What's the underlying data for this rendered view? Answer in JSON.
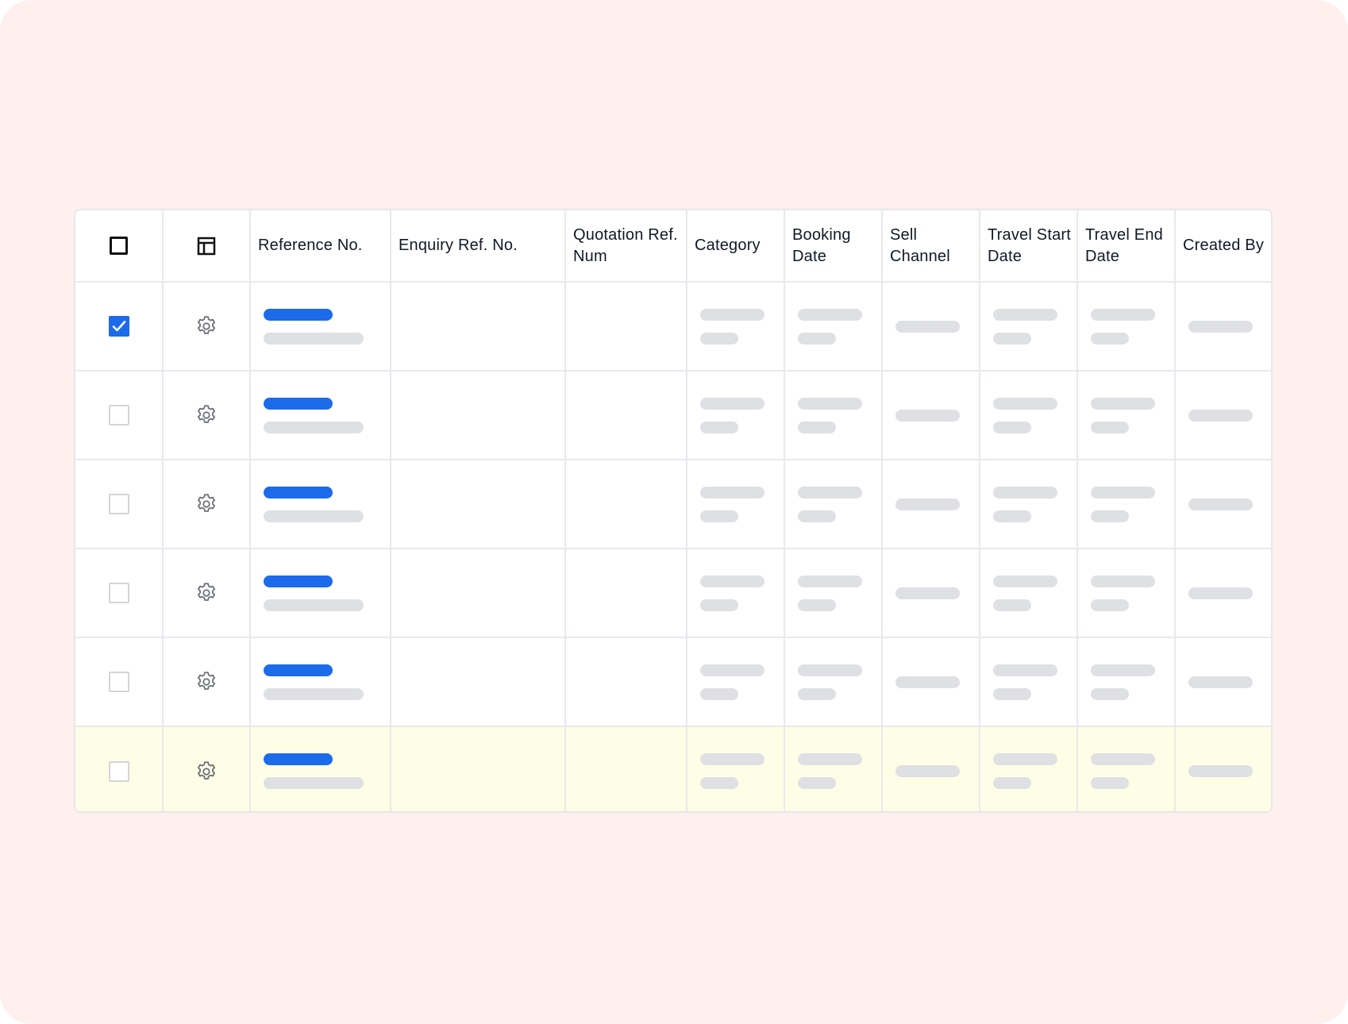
{
  "table": {
    "columns": [
      {
        "key": "select",
        "label": ""
      },
      {
        "key": "settings",
        "label": ""
      },
      {
        "key": "reference_no",
        "label": "Reference No."
      },
      {
        "key": "enquiry_ref_no",
        "label": "Enquiry Ref. No."
      },
      {
        "key": "quotation_ref_num",
        "label": "Quotation Ref. Num"
      },
      {
        "key": "category",
        "label": "Category"
      },
      {
        "key": "booking_date",
        "label": "Booking Date"
      },
      {
        "key": "sell_channel",
        "label": "Sell Channel"
      },
      {
        "key": "travel_start_date",
        "label": "Travel Start Date"
      },
      {
        "key": "travel_end_date",
        "label": "Travel End Date"
      },
      {
        "key": "created_by",
        "label": "Created By"
      }
    ],
    "header_icons": {
      "select_all": "checkbox-unchecked-icon",
      "column_layout": "layout-icon"
    },
    "rows": [
      {
        "selected": true,
        "highlighted": false,
        "row_icon": "gear-icon"
      },
      {
        "selected": false,
        "highlighted": false,
        "row_icon": "gear-icon"
      },
      {
        "selected": false,
        "highlighted": false,
        "row_icon": "gear-icon"
      },
      {
        "selected": false,
        "highlighted": false,
        "row_icon": "gear-icon"
      },
      {
        "selected": false,
        "highlighted": false,
        "row_icon": "gear-icon"
      },
      {
        "selected": false,
        "highlighted": true,
        "row_icon": "gear-icon"
      }
    ]
  },
  "colors": {
    "page_background": "#fff0ee",
    "accent_blue": "#1b6bea",
    "skeleton_gray": "#dfe0e4",
    "highlight_row": "#fefee7",
    "border": "#e8e9ec"
  }
}
